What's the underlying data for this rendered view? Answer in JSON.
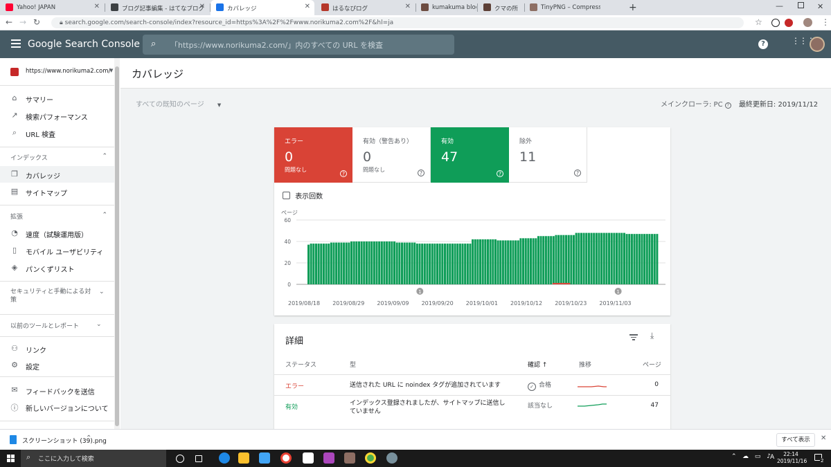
{
  "browser": {
    "tabs": [
      {
        "label": "Yahoo! JAPAN",
        "active": false,
        "color": "#ff0033"
      },
      {
        "label": "ブログ記事編集 - はてなブログ",
        "active": false,
        "color": "#3c4043"
      },
      {
        "label": "カバレッジ",
        "active": true,
        "color": "#1a73e8"
      },
      {
        "label": "はるなぴログ",
        "active": false,
        "color": "#b5372a"
      },
      {
        "label": "kumakuma blog",
        "active": false,
        "color": "#6d4c41"
      },
      {
        "label": "クマの所",
        "active": false,
        "color": "#5d4037"
      },
      {
        "label": "TinyPNG – Compress PNG image",
        "active": false,
        "color": "#8d6e63"
      }
    ],
    "url": "search.google.com/search-console/index?resource_id=https%3A%2F%2Fwww.norikuma2.com%2F&hl=ja"
  },
  "header": {
    "logo": "Google Search Console",
    "search_placeholder": "「https://www.norikuma2.com/」内のすべての URL を検査"
  },
  "sidebar": {
    "property": "https://www.norikuma2.com/",
    "top_items": [
      {
        "label": "サマリー",
        "icon": "home-icon"
      },
      {
        "label": "検索パフォーマンス",
        "icon": "trend-icon"
      },
      {
        "label": "URL 検査",
        "icon": "search-icon"
      }
    ],
    "index_heading": "インデックス",
    "index_items": [
      {
        "label": "カバレッジ",
        "icon": "copy-icon",
        "active": true
      },
      {
        "label": "サイトマップ",
        "icon": "sitemap-icon"
      }
    ],
    "ext_heading": "拡張",
    "ext_items": [
      {
        "label": "速度（試験運用版）",
        "icon": "speed-icon"
      },
      {
        "label": "モバイル ユーザビリティ",
        "icon": "mobile-icon"
      },
      {
        "label": "パンくずリスト",
        "icon": "layers-icon"
      }
    ],
    "security_heading": "セキュリティと手動による対策",
    "legacy_heading": "以前のツールとレポート",
    "bottom_items": [
      {
        "label": "リンク",
        "icon": "links-icon"
      },
      {
        "label": "設定",
        "icon": "settings-icon"
      },
      {
        "label": "フィードバックを送信",
        "icon": "feedback-icon"
      },
      {
        "label": "新しいバージョンについて",
        "icon": "info-icon"
      }
    ]
  },
  "page": {
    "title": "カバレッジ",
    "filter": "すべての既知のページ",
    "crawler": "メインクローラ: PC",
    "updated": "最終更新日: 2019/11/12"
  },
  "stats": [
    {
      "label": "エラー",
      "value": "0",
      "sub": "問題なし",
      "bg": "#d94336",
      "fg": "#ffffff"
    },
    {
      "label": "有効（警告あり）",
      "value": "0",
      "sub": "問題なし",
      "bg": "#ffffff",
      "fg": "#5f6368"
    },
    {
      "label": "有効",
      "value": "47",
      "sub": "",
      "bg": "#0f9d58",
      "fg": "#ffffff"
    },
    {
      "label": "除外",
      "value": "11",
      "sub": "",
      "bg": "#ffffff",
      "fg": "#5f6368"
    }
  ],
  "impressions_label": "表示回数",
  "chart_data": {
    "type": "bar",
    "ylabel": "ページ",
    "ylim": [
      0,
      60
    ],
    "yticks": [
      0,
      20,
      40,
      60
    ],
    "xticks": [
      "2019/08/18",
      "2019/08/29",
      "2019/09/09",
      "2019/09/20",
      "2019/10/01",
      "2019/10/12",
      "2019/10/23",
      "2019/11/03"
    ],
    "series": [
      {
        "color": "#0f9d58",
        "values": [
          37,
          38,
          38,
          38,
          38,
          38,
          38,
          38,
          38,
          39,
          39,
          39,
          39,
          39,
          39,
          39,
          39,
          40,
          40,
          40,
          40,
          40,
          40,
          40,
          40,
          40,
          40,
          40,
          40,
          40,
          40,
          40,
          40,
          40,
          40,
          39,
          39,
          39,
          39,
          39,
          39,
          39,
          39,
          38,
          38,
          38,
          38,
          38,
          38,
          38,
          38,
          38,
          38,
          38,
          38,
          38,
          38,
          38,
          38,
          38,
          38,
          38,
          38,
          38,
          38,
          42,
          42,
          42,
          42,
          42,
          42,
          42,
          42,
          42,
          42,
          41,
          41,
          41,
          41,
          41,
          41,
          41,
          41,
          41,
          43,
          43,
          43,
          43,
          43,
          43,
          43,
          45,
          45,
          45,
          45,
          45,
          45,
          45,
          46,
          46,
          46,
          46,
          46,
          46,
          46,
          46,
          48,
          48,
          48,
          48,
          48,
          48,
          48,
          48,
          48,
          48,
          48,
          48,
          48,
          48,
          48,
          48,
          48,
          48,
          48,
          48,
          47,
          47,
          47,
          47,
          47,
          47,
          47,
          47,
          47,
          47,
          47,
          47,
          47
        ]
      },
      {
        "color": "#d94336",
        "values": [
          0,
          0,
          0,
          0,
          0,
          0,
          0,
          0,
          0,
          0,
          0,
          0,
          0,
          0,
          0,
          0,
          0,
          0,
          0,
          0,
          0,
          0,
          0,
          0,
          0,
          0,
          0,
          0,
          0,
          0,
          0,
          0,
          0,
          0,
          0,
          0,
          0,
          0,
          0,
          0,
          0,
          0,
          0,
          0,
          0,
          0,
          0,
          0,
          0,
          0,
          0,
          0,
          0,
          0,
          0,
          0,
          0,
          0,
          0,
          0,
          0,
          0,
          0,
          0,
          0,
          0,
          0,
          0,
          0,
          0,
          0,
          0,
          0,
          0,
          0,
          0,
          0,
          0,
          0,
          0,
          0,
          0,
          0,
          0,
          0,
          0,
          0,
          0,
          0,
          0,
          0,
          0,
          0,
          0,
          0,
          0,
          0,
          1,
          1,
          1,
          1,
          1,
          1,
          1,
          0,
          0,
          0,
          0,
          0,
          0,
          0,
          0,
          0,
          0,
          0,
          0,
          0,
          0,
          0,
          0,
          0,
          0,
          0,
          0,
          0,
          0,
          0,
          0,
          0,
          0,
          0,
          0,
          0,
          0,
          0,
          0,
          0,
          0,
          0
        ]
      }
    ],
    "annotations": [
      {
        "label": "1",
        "at": "2019/10/01"
      },
      {
        "label": "1",
        "at": "2019/11/04"
      }
    ]
  },
  "details": {
    "title": "詳細",
    "headers": {
      "status": "ステータス",
      "type": "型",
      "validation": "確認",
      "trend": "推移",
      "pages": "ページ"
    },
    "rows": [
      {
        "status": "エラー",
        "status_color": "#d94336",
        "type": "送信された URL に noindex タグが追加されています",
        "validation": "合格",
        "pages": "0",
        "trend_color": "#d94336"
      },
      {
        "status": "有効",
        "status_color": "#0f9d58",
        "type": "インデックス登録されましたが、サイトマップに送信していません",
        "validation": "該当なし",
        "pages": "47",
        "trend_color": "#0f9d58"
      }
    ]
  },
  "download": {
    "file": "スクリーンショット (39).png",
    "show_all": "すべて表示"
  },
  "taskbar": {
    "search": "ここに入力して検索",
    "time": "22:14",
    "date": "2019/11/16",
    "badge": "2"
  }
}
